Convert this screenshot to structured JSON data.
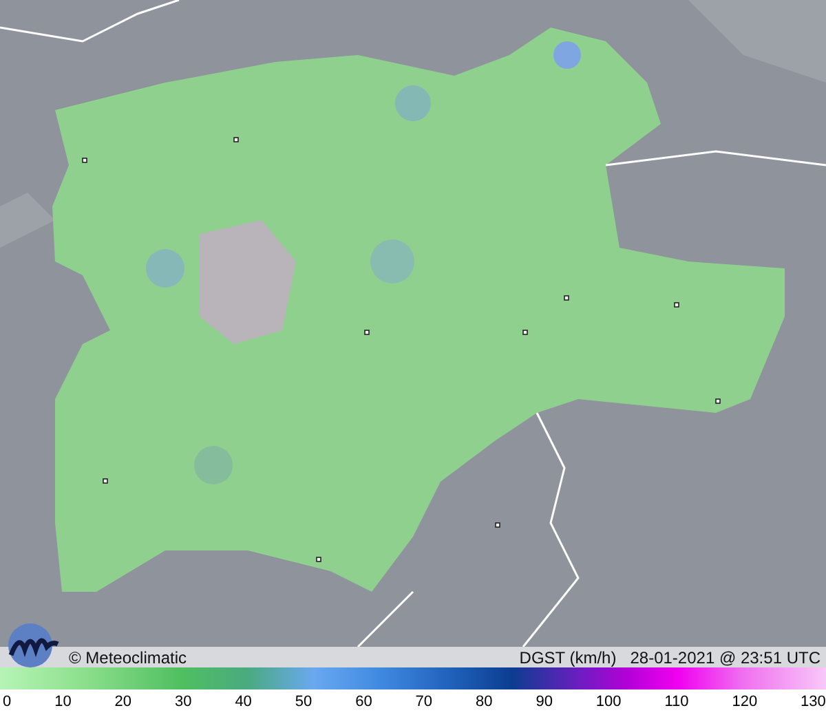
{
  "map": {
    "credit": "© Meteoclimatic",
    "title": "DGST (km/h)   28-01-2021 @ 23:51 UTC"
  },
  "legend": {
    "ticks": [
      "0",
      "10",
      "20",
      "30",
      "40",
      "50",
      "60",
      "70",
      "80",
      "90",
      "100",
      "110",
      "120",
      "130"
    ]
  }
}
